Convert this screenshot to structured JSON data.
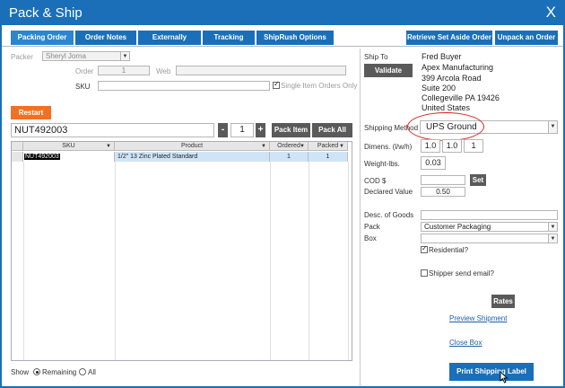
{
  "window": {
    "title": "Pack & Ship",
    "close_glyph": "X"
  },
  "tabs": [
    {
      "label": "Packing Order",
      "active": true
    },
    {
      "label": "Order Notes"
    },
    {
      "label": "Externally Shipped"
    },
    {
      "label": "Tracking"
    },
    {
      "label": "ShipRush Options"
    }
  ],
  "right_tabs": [
    {
      "label": "Retrieve Set Aside Order"
    },
    {
      "label": "Unpack an Order"
    }
  ],
  "packer": {
    "label": "Packer",
    "value": "Sheryl Jorna"
  },
  "order": {
    "label": "Order",
    "value": "1",
    "web_label": "Web",
    "web_value": ""
  },
  "sku": {
    "label": "SKU",
    "value": "",
    "single_item_label": "Single Item Orders Only",
    "single_item_checked": true
  },
  "restart_label": "Restart",
  "scan": {
    "value": "NUT492003",
    "minus": "-",
    "qty": "1",
    "plus": "+",
    "pack_item": "Pack Item",
    "pack_all": "Pack All"
  },
  "grid": {
    "columns": [
      "SKU",
      "Product",
      "Ordered",
      "Packed"
    ],
    "rows": [
      {
        "sku": "NUT492003",
        "product": "1/2\" 13 Zinc Plated Standard",
        "ordered": "1",
        "packed": "1"
      }
    ]
  },
  "show": {
    "label": "Show",
    "remaining": "Remaining",
    "all": "All",
    "selected": "Remaining"
  },
  "ship_to": {
    "label": "Ship To",
    "validate": "Validate",
    "lines": [
      "Fred Buyer",
      "Apex Manufacturing",
      "399 Arcola Road",
      "Suite 200",
      "Collegeville PA 19426",
      "United States"
    ]
  },
  "shipping_method": {
    "label": "Shipping Method",
    "value": "UPS Ground"
  },
  "dimens": {
    "label": "Dimens. (l/w/h)",
    "l": "1.0",
    "w": "1.0",
    "h": "1"
  },
  "weight": {
    "label": "Weight-lbs.",
    "value": "0.03"
  },
  "cod": {
    "label": "COD $",
    "value": "",
    "set": "Set"
  },
  "declared": {
    "label": "Declared Value",
    "value": "0.50"
  },
  "desc_goods": {
    "label": "Desc. of Goods",
    "value": ""
  },
  "pack": {
    "label": "Pack",
    "value": "Customer Packaging"
  },
  "box": {
    "label": "Box",
    "value": ""
  },
  "residential": {
    "label": "Residential?",
    "checked": true
  },
  "shipper_email": {
    "label": "Shipper send email?",
    "checked": false
  },
  "rates_label": "Rates",
  "preview_shipment": "Preview Shipment",
  "close_box": "Close Box",
  "print_label": "Print Shipping Label",
  "dropdown_glyph": "▼",
  "colors": {
    "accent": "#1a6fb8",
    "orange": "#f37022",
    "highlight": "#d22222"
  }
}
